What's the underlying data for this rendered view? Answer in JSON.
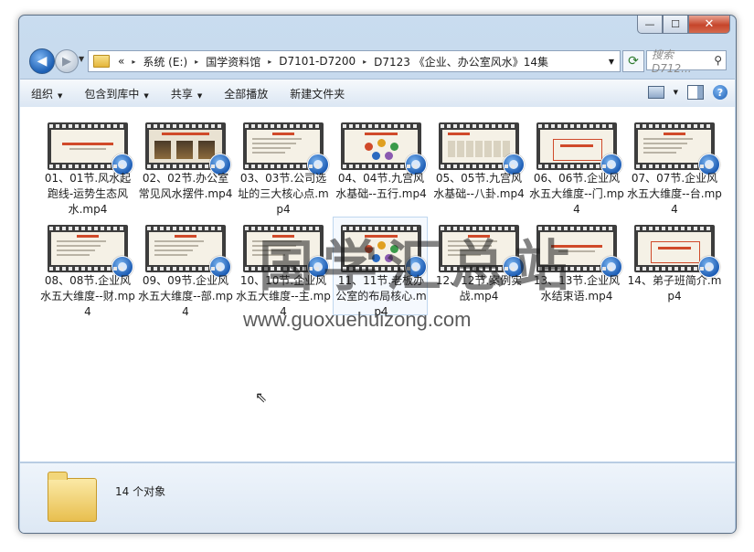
{
  "window": {
    "controls": {
      "minimize": "—",
      "maximize": "☐",
      "close": "✕"
    }
  },
  "nav": {
    "back_icon": "arrow-left-icon",
    "forward_icon": "arrow-right-icon",
    "breadcrumb_prefix": "«",
    "breadcrumbs": [
      "系统 (E:)",
      "国学资料馆",
      "D7101-D7200",
      "D7123 《企业、办公室风水》14集"
    ],
    "crumb_sep": "▸",
    "search_placeholder": "搜索 D712...",
    "search_icon": "search-icon"
  },
  "toolbar": {
    "organize": "组织",
    "include_library": "包含到库中",
    "share": "共享",
    "play_all": "全部播放",
    "new_folder": "新建文件夹"
  },
  "files": [
    {
      "name": "01、01节.风水起跑线-运势生态风水.mp4",
      "style": "title"
    },
    {
      "name": "02、02节.办公室常见风水摆件.mp4",
      "style": "photo"
    },
    {
      "name": "03、03节.公司选址的三大核心点.mp4",
      "style": "lines"
    },
    {
      "name": "04、04节.九宫风水基础--五行.mp4",
      "style": "circles"
    },
    {
      "name": "05、05节.九宫风水基础--八卦.mp4",
      "style": "grid"
    },
    {
      "name": "06、06节.企业风水五大维度--门.mp4",
      "style": "box"
    },
    {
      "name": "07、07节.企业风水五大维度--台.mp4",
      "style": "lines"
    },
    {
      "name": "08、08节.企业风水五大维度--财.mp4",
      "style": "lines"
    },
    {
      "name": "09、09节.企业风水五大维度--部.mp4",
      "style": "lines"
    },
    {
      "name": "10、10节.企业风水五大维度--主.mp4",
      "style": "lines"
    },
    {
      "name": "11、11节.老板办公室的布局核心.mp4",
      "style": "circles"
    },
    {
      "name": "12、12节.案例实战.mp4",
      "style": "lines"
    },
    {
      "name": "13、13节.企业风水结束语.mp4",
      "style": "title"
    },
    {
      "name": "14、弟子班简介.mp4",
      "style": "box"
    }
  ],
  "selected_index": 10,
  "watermark": {
    "cn": "国学汇总站",
    "url": "www.guoxuehuizong.com"
  },
  "details": {
    "count": "14 个对象"
  },
  "colors": {
    "accent": "#1d5db5",
    "titlebar": "#c9dcef"
  }
}
